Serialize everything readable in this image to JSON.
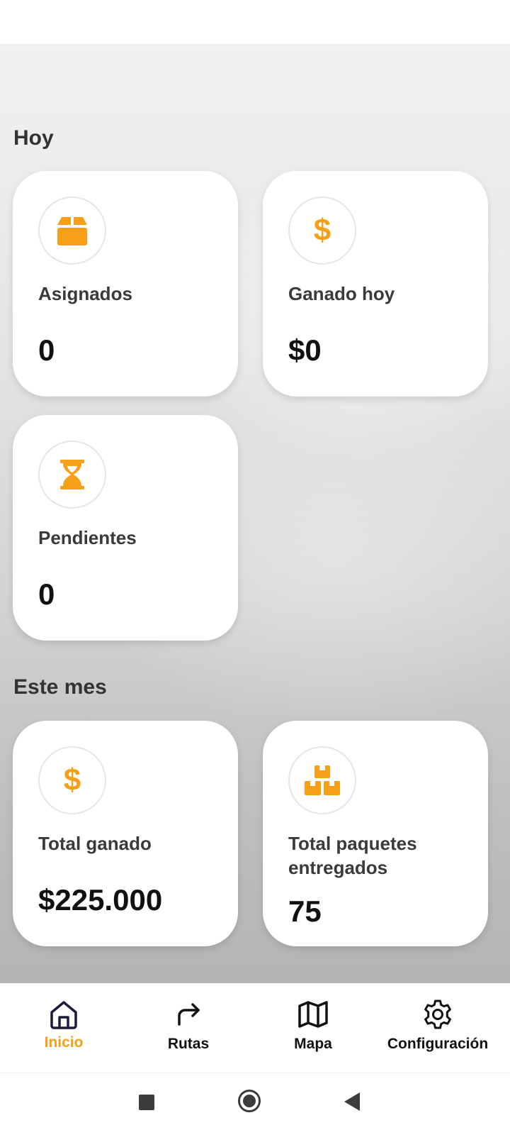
{
  "colors": {
    "accent": "#F6A01A",
    "text_dark": "#111111",
    "background": "#F1F1F1"
  },
  "sections": {
    "today": {
      "title": "Hoy",
      "cards": [
        {
          "icon": "box-icon",
          "label": "Asignados",
          "value": "0"
        },
        {
          "icon": "dollar-icon",
          "label": "Ganado hoy",
          "value": "$0"
        },
        {
          "icon": "hourglass-icon",
          "label": "Pendientes",
          "value": "0"
        }
      ]
    },
    "month": {
      "title": "Este mes",
      "cards": [
        {
          "icon": "dollar-icon",
          "label": "Total ganado",
          "value": "$225.000"
        },
        {
          "icon": "boxes-icon",
          "label": "Total paquetes entregados",
          "value": "75"
        }
      ]
    }
  },
  "bottom_nav": {
    "active": "Inicio",
    "items": [
      {
        "label": "Inicio",
        "icon": "home-icon"
      },
      {
        "label": "Rutas",
        "icon": "route-arrow-icon"
      },
      {
        "label": "Mapa",
        "icon": "map-icon"
      },
      {
        "label": "Configuración",
        "icon": "gear-icon"
      }
    ]
  },
  "system_nav": {
    "icons": [
      "recents-square-icon",
      "home-circle-icon",
      "back-triangle-icon"
    ]
  }
}
